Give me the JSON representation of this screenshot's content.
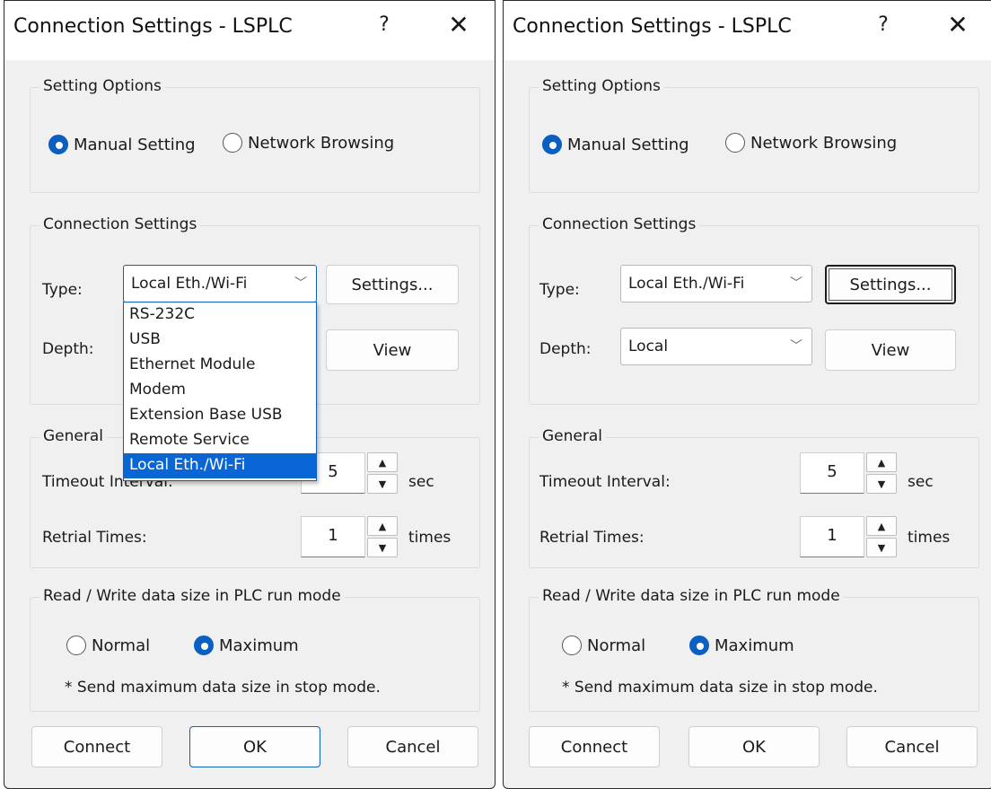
{
  "dialogs": [
    {
      "title": "Connection Settings - LSPLC",
      "help_label": "?",
      "close_label": "✕",
      "setting_options": {
        "legend": "Setting Options",
        "manual_label": "Manual Setting",
        "browse_label": "Network Browsing",
        "selected": "manual"
      },
      "connection": {
        "legend": "Connection Settings",
        "type_label": "Type:",
        "type_value": "Local Eth./Wi-Fi",
        "settings_label": "Settings...",
        "depth_label": "Depth:",
        "view_label": "View",
        "dropdown_open": true,
        "dropdown_items": [
          "RS-232C",
          "USB",
          "Ethernet Module",
          "Modem",
          "Extension Base USB",
          "Remote Service",
          "Local Eth./Wi-Fi"
        ]
      },
      "general": {
        "legend": "General",
        "timeout_label": "Timeout Interval:",
        "timeout_value": "5",
        "timeout_unit": "sec",
        "retrial_label": "Retrial Times:",
        "retrial_value": "1",
        "retrial_unit": "times"
      },
      "rw": {
        "legend": "Read / Write data size in PLC run mode",
        "normal_label": "Normal",
        "maximum_label": "Maximum",
        "selected": "maximum",
        "note": "* Send maximum data size in stop mode."
      },
      "footer": {
        "connect_label": "Connect",
        "ok_label": "OK",
        "cancel_label": "Cancel"
      }
    },
    {
      "title": "Connection Settings - LSPLC",
      "help_label": "?",
      "close_label": "✕",
      "setting_options": {
        "legend": "Setting Options",
        "manual_label": "Manual Setting",
        "browse_label": "Network Browsing",
        "selected": "manual"
      },
      "connection": {
        "legend": "Connection Settings",
        "type_label": "Type:",
        "type_value": "Local Eth./Wi-Fi",
        "settings_label": "Settings...",
        "depth_label": "Depth:",
        "depth_value": "Local",
        "view_label": "View"
      },
      "general": {
        "legend": "General",
        "timeout_label": "Timeout Interval:",
        "timeout_value": "5",
        "timeout_unit": "sec",
        "retrial_label": "Retrial Times:",
        "retrial_value": "1",
        "retrial_unit": "times"
      },
      "rw": {
        "legend": "Read / Write data size in PLC run mode",
        "normal_label": "Normal",
        "maximum_label": "Maximum",
        "selected": "maximum",
        "note": "* Send maximum data size in stop mode."
      },
      "footer": {
        "connect_label": "Connect",
        "ok_label": "OK",
        "cancel_label": "Cancel"
      }
    }
  ],
  "icons": {
    "dropdown": "chevron-down-icon",
    "spin_up": "triangle-up-icon",
    "spin_down": "triangle-down-icon",
    "radio": "radio-icon"
  },
  "colors": {
    "accent": "#0a5fc0",
    "selection": "#0a66d4",
    "dialog_bg": "#f0f0f0"
  }
}
